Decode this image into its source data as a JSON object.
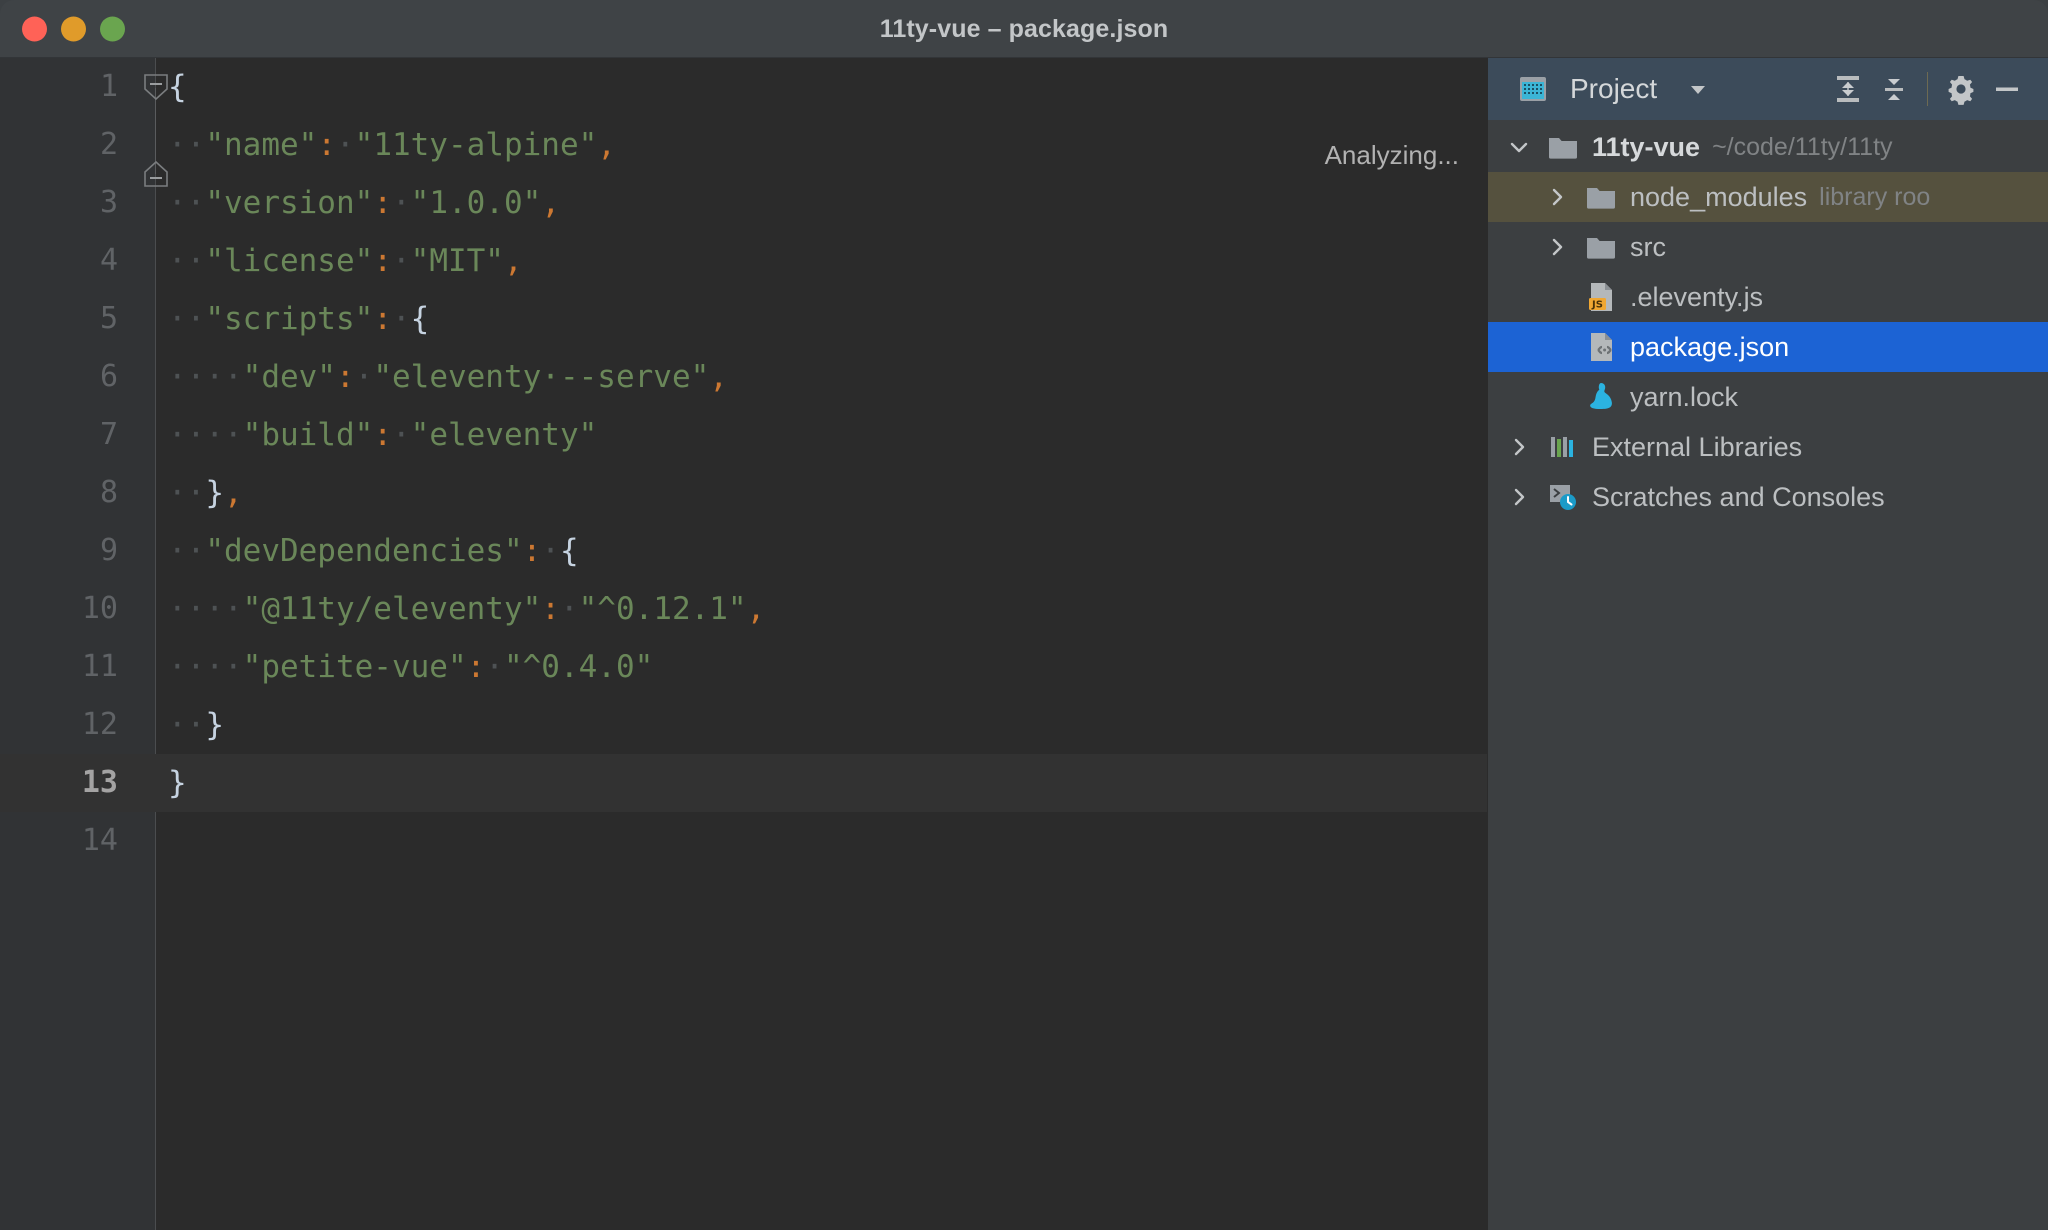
{
  "window": {
    "title": "11ty-vue – package.json",
    "traffic_lights": [
      {
        "name": "close",
        "color": "#ff6257"
      },
      {
        "name": "minimize",
        "color": "#e09b2a"
      },
      {
        "name": "zoom",
        "color": "#6aa54f"
      }
    ]
  },
  "editor": {
    "status_text": "Analyzing...",
    "background": "#2b2b2b",
    "gutter_background": "#313335",
    "current_line": 13,
    "total_visible_lines": 14,
    "filename": "package.json",
    "lines": [
      {
        "n": 1,
        "tokens": [
          {
            "t": "{",
            "c": "brace"
          }
        ]
      },
      {
        "n": 2,
        "tokens": [
          {
            "t": "··",
            "c": "ws"
          },
          {
            "t": "\"name\"",
            "c": "key"
          },
          {
            "t": ":",
            "c": "punct"
          },
          {
            "t": "·",
            "c": "ws"
          },
          {
            "t": "\"11ty-alpine\"",
            "c": "str"
          },
          {
            "t": ",",
            "c": "punct"
          }
        ]
      },
      {
        "n": 3,
        "tokens": [
          {
            "t": "··",
            "c": "ws"
          },
          {
            "t": "\"version\"",
            "c": "key"
          },
          {
            "t": ":",
            "c": "punct"
          },
          {
            "t": "·",
            "c": "ws"
          },
          {
            "t": "\"1.0.0\"",
            "c": "str"
          },
          {
            "t": ",",
            "c": "punct"
          }
        ]
      },
      {
        "n": 4,
        "tokens": [
          {
            "t": "··",
            "c": "ws"
          },
          {
            "t": "\"license\"",
            "c": "key"
          },
          {
            "t": ":",
            "c": "punct"
          },
          {
            "t": "·",
            "c": "ws"
          },
          {
            "t": "\"MIT\"",
            "c": "str"
          },
          {
            "t": ",",
            "c": "punct"
          }
        ]
      },
      {
        "n": 5,
        "tokens": [
          {
            "t": "··",
            "c": "ws"
          },
          {
            "t": "\"scripts\"",
            "c": "key"
          },
          {
            "t": ":",
            "c": "punct"
          },
          {
            "t": "·",
            "c": "ws"
          },
          {
            "t": "{",
            "c": "brace"
          }
        ]
      },
      {
        "n": 6,
        "tokens": [
          {
            "t": "····",
            "c": "ws"
          },
          {
            "t": "\"dev\"",
            "c": "key"
          },
          {
            "t": ":",
            "c": "punct"
          },
          {
            "t": "·",
            "c": "ws"
          },
          {
            "t": "\"eleventy·--serve\"",
            "c": "str"
          },
          {
            "t": ",",
            "c": "punct"
          }
        ]
      },
      {
        "n": 7,
        "tokens": [
          {
            "t": "····",
            "c": "ws"
          },
          {
            "t": "\"build\"",
            "c": "key"
          },
          {
            "t": ":",
            "c": "punct"
          },
          {
            "t": "·",
            "c": "ws"
          },
          {
            "t": "\"eleventy\"",
            "c": "str"
          }
        ]
      },
      {
        "n": 8,
        "tokens": [
          {
            "t": "··",
            "c": "ws"
          },
          {
            "t": "}",
            "c": "brace"
          },
          {
            "t": ",",
            "c": "punct"
          }
        ]
      },
      {
        "n": 9,
        "tokens": [
          {
            "t": "··",
            "c": "ws"
          },
          {
            "t": "\"devDependencies\"",
            "c": "key"
          },
          {
            "t": ":",
            "c": "punct"
          },
          {
            "t": "·",
            "c": "ws"
          },
          {
            "t": "{",
            "c": "brace"
          }
        ]
      },
      {
        "n": 10,
        "tokens": [
          {
            "t": "····",
            "c": "ws"
          },
          {
            "t": "\"@11ty/eleventy\"",
            "c": "key"
          },
          {
            "t": ":",
            "c": "punct"
          },
          {
            "t": "·",
            "c": "ws"
          },
          {
            "t": "\"^0.12.1\"",
            "c": "str"
          },
          {
            "t": ",",
            "c": "punct"
          }
        ]
      },
      {
        "n": 11,
        "tokens": [
          {
            "t": "····",
            "c": "ws"
          },
          {
            "t": "\"petite-vue\"",
            "c": "key"
          },
          {
            "t": ":",
            "c": "punct"
          },
          {
            "t": "·",
            "c": "ws"
          },
          {
            "t": "\"^0.4.0\"",
            "c": "str"
          }
        ]
      },
      {
        "n": 12,
        "tokens": [
          {
            "t": "··",
            "c": "ws"
          },
          {
            "t": "}",
            "c": "brace"
          }
        ]
      },
      {
        "n": 13,
        "tokens": [
          {
            "t": "}",
            "c": "brace"
          }
        ]
      },
      {
        "n": 14,
        "tokens": []
      }
    ]
  },
  "panel": {
    "title": "Project",
    "accent_selection": "#1c63d4",
    "library_row_color": "#55513e",
    "header_background": "#3c4b5a",
    "toolbar": [
      {
        "name": "project-view-icon",
        "label": ""
      },
      {
        "name": "chevron-down-icon",
        "label": ""
      },
      {
        "name": "expand-all-icon",
        "label": ""
      },
      {
        "name": "collapse-all-icon",
        "label": ""
      },
      {
        "name": "gear-icon",
        "label": ""
      },
      {
        "name": "hide-panel-icon",
        "label": ""
      }
    ],
    "tree": [
      {
        "label": "11ty-vue",
        "hint": "~/code/11ty/11ty",
        "icon": "folder-icon",
        "twisty": "expanded",
        "depth": 1,
        "selected": false,
        "library": false,
        "bold": true
      },
      {
        "label": "node_modules",
        "hint": "library roo",
        "icon": "folder-icon",
        "twisty": "collapsed",
        "depth": 2,
        "selected": false,
        "library": true,
        "bold": false
      },
      {
        "label": "src",
        "hint": "",
        "icon": "folder-icon",
        "twisty": "collapsed",
        "depth": 2,
        "selected": false,
        "library": false,
        "bold": false
      },
      {
        "label": ".eleventy.js",
        "hint": "",
        "icon": "js-file-icon",
        "twisty": "none",
        "depth": 2,
        "selected": false,
        "library": false,
        "bold": false
      },
      {
        "label": "package.json",
        "hint": "",
        "icon": "json-file-icon",
        "twisty": "none",
        "depth": 2,
        "selected": true,
        "library": false,
        "bold": false
      },
      {
        "label": "yarn.lock",
        "hint": "",
        "icon": "yarn-icon",
        "twisty": "none",
        "depth": 2,
        "selected": false,
        "library": false,
        "bold": false
      },
      {
        "label": "External Libraries",
        "hint": "",
        "icon": "libraries-icon",
        "twisty": "collapsed",
        "depth": 1,
        "selected": false,
        "library": false,
        "bold": false
      },
      {
        "label": "Scratches and Consoles",
        "hint": "",
        "icon": "scratches-icon",
        "twisty": "collapsed",
        "depth": 1,
        "selected": false,
        "library": false,
        "bold": false
      }
    ]
  }
}
